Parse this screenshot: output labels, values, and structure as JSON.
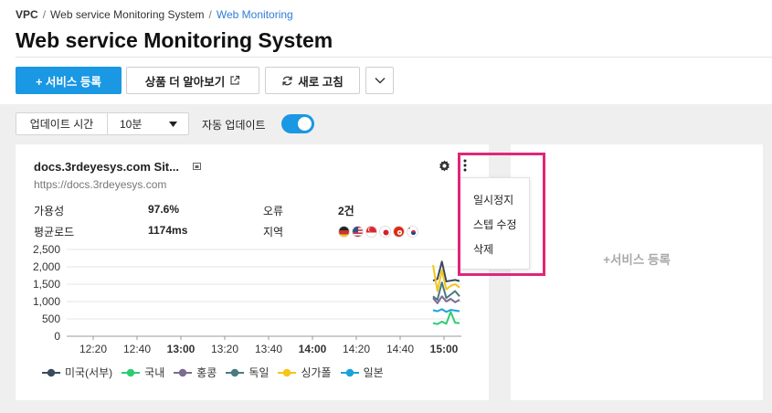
{
  "breadcrumb": {
    "root": "VPC",
    "parent": "Web service Monitoring System",
    "current": "Web Monitoring",
    "separator": "/"
  },
  "page_title": "Web service Monitoring System",
  "toolbar": {
    "register_label": "+ 서비스 등록",
    "learn_more_label": "상품 더 알아보기",
    "refresh_label": "새로 고침"
  },
  "update_bar": {
    "interval_label": "업데이트 시간",
    "interval_value": "10분",
    "auto_update_label": "자동 업데이트",
    "auto_update_on": true
  },
  "card": {
    "title": "docs.3rdeyesys.com Sit...",
    "url": "https://docs.3rdeyesys.com",
    "availability_label": "가용성",
    "availability_value": "97.6%",
    "avg_load_label": "평균로드",
    "avg_load_value": "1174ms",
    "errors_label": "오류",
    "errors_value": "2건",
    "region_label": "지역",
    "region_flags": [
      "germany-flag",
      "usa-flag",
      "singapore-flag",
      "japan-flag",
      "hong-kong-flag",
      "korea-flag"
    ]
  },
  "menu": {
    "items": [
      "일시정지",
      "스텝 수정",
      "삭제"
    ]
  },
  "add_service_label": "+서비스 등록",
  "legend": [
    {
      "label": "미국(서부)",
      "color": "#3b4a5c"
    },
    {
      "label": "국내",
      "color": "#2ecc71"
    },
    {
      "label": "홍콩",
      "color": "#7d6b91"
    },
    {
      "label": "독일",
      "color": "#4a7a82"
    },
    {
      "label": "싱가폴",
      "color": "#f5c518"
    },
    {
      "label": "일본",
      "color": "#1aa3d9"
    }
  ],
  "chart_data": {
    "type": "line",
    "ylim": [
      0,
      2500
    ],
    "y_ticks": [
      "0",
      "500",
      "1,000",
      "1,500",
      "2,000",
      "2,500"
    ],
    "x_ticks": [
      {
        "label": "12:20",
        "bold": false
      },
      {
        "label": "12:40",
        "bold": false
      },
      {
        "label": "13:00",
        "bold": true
      },
      {
        "label": "13:20",
        "bold": false
      },
      {
        "label": "13:40",
        "bold": false
      },
      {
        "label": "14:00",
        "bold": true
      },
      {
        "label": "14:20",
        "bold": false
      },
      {
        "label": "14:40",
        "bold": false
      },
      {
        "label": "15:00",
        "bold": true
      }
    ],
    "x": [
      "14:56",
      "14:57",
      "14:58",
      "14:59",
      "15:00",
      "15:01",
      "15:02"
    ],
    "series": [
      {
        "name": "미국(서부)",
        "values": [
          1600,
          1650,
          2150,
          1580,
          1600,
          1620,
          1590
        ]
      },
      {
        "name": "국내",
        "values": [
          380,
          350,
          420,
          360,
          700,
          390,
          380
        ]
      },
      {
        "name": "홍콩",
        "values": [
          1100,
          950,
          1150,
          1000,
          1080,
          980,
          1050
        ]
      },
      {
        "name": "독일",
        "values": [
          1150,
          1050,
          1550,
          1100,
          1200,
          1300,
          1150
        ]
      },
      {
        "name": "싱가폴",
        "values": [
          2050,
          1300,
          1900,
          1350,
          1450,
          1500,
          1400
        ]
      },
      {
        "name": "일본",
        "values": [
          750,
          720,
          780,
          700,
          760,
          740,
          720
        ]
      }
    ]
  }
}
